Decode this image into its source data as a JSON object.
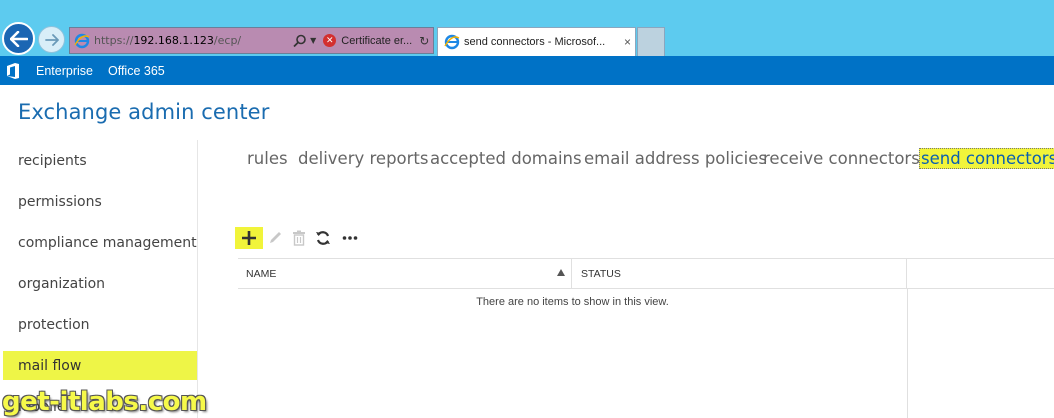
{
  "browser": {
    "url_prefix": "https://",
    "url_host": "192.168.1.123",
    "url_path": "/ecp/",
    "certificate_error": "Certificate er...",
    "tab_title": "send connectors - Microsof...",
    "tab_close": "×",
    "icons": [
      "back-arrow-icon",
      "forward-arrow-icon",
      "ie-icon",
      "search-icon",
      "certificate-error-icon",
      "refresh-icon",
      "close-icon"
    ]
  },
  "office_bar": {
    "items": [
      "Enterprise",
      "Office 365"
    ],
    "color": "#0072c6"
  },
  "title": "Exchange admin center",
  "left_nav": {
    "items": [
      {
        "label": "recipients",
        "active": false
      },
      {
        "label": "permissions",
        "active": false
      },
      {
        "label": "compliance management",
        "active": false
      },
      {
        "label": "organization",
        "active": false
      },
      {
        "label": "protection",
        "active": false
      },
      {
        "label": "mail flow",
        "active": true
      },
      {
        "label": "mobile",
        "active": false
      }
    ],
    "highlight_color": "#eef547"
  },
  "sub_tabs": [
    {
      "label": "rules",
      "active": false
    },
    {
      "label": "delivery reports",
      "active": false
    },
    {
      "label": "accepted domains",
      "active": false
    },
    {
      "label": "email address policies",
      "active": false
    },
    {
      "label": "receive connectors",
      "active": false
    },
    {
      "label": "send connectors",
      "active": true
    }
  ],
  "toolbar": {
    "icons": [
      "add-icon",
      "edit-icon",
      "delete-icon",
      "refresh-icon",
      "more-icon"
    ],
    "more_label": "•••"
  },
  "grid": {
    "columns": [
      "NAME",
      "STATUS"
    ],
    "empty_message": "There are no items to show in this view."
  },
  "watermark": "get-itlabs.com"
}
